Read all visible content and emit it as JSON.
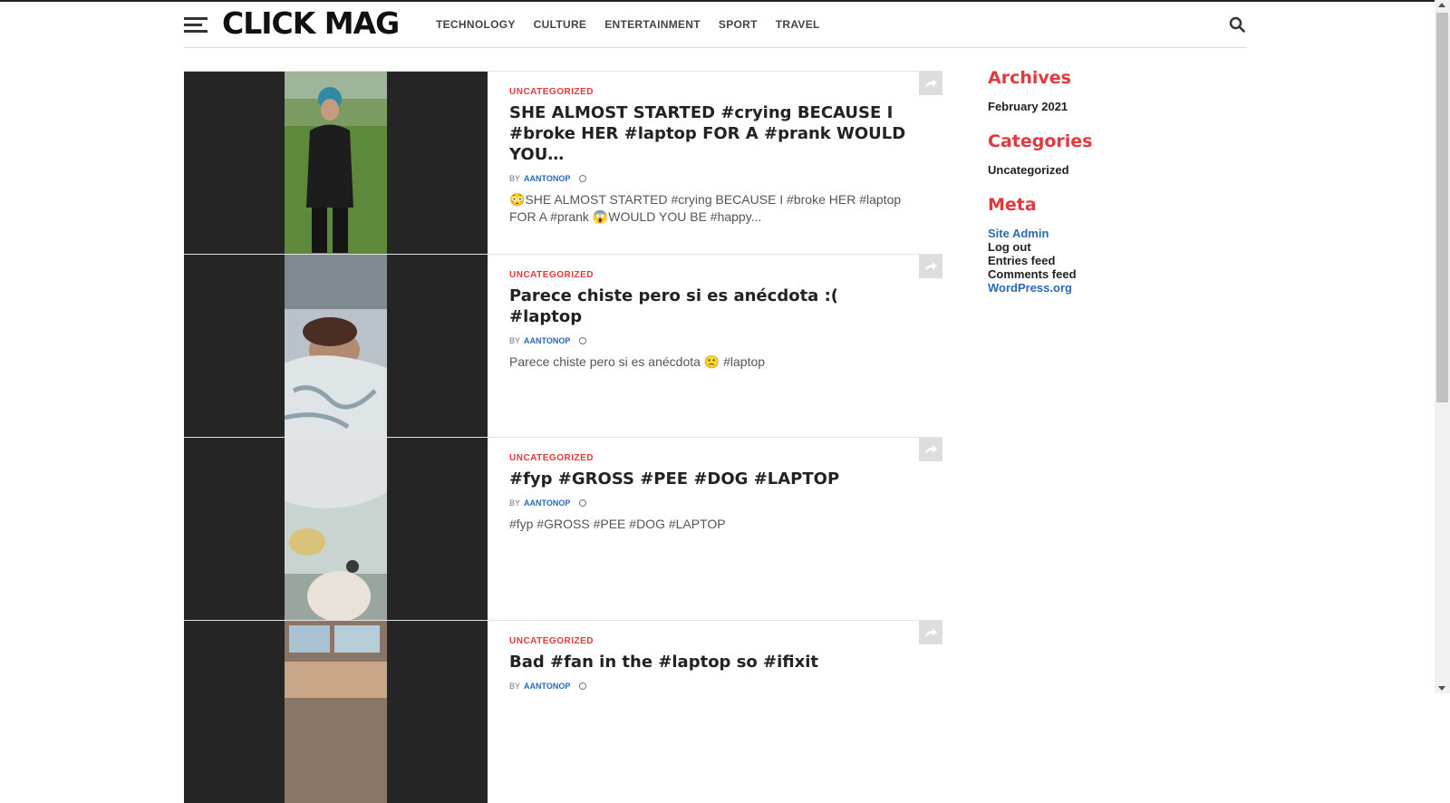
{
  "header": {
    "logo": "CLICK MAG",
    "nav": [
      "TECHNOLOGY",
      "CULTURE",
      "ENTERTAINMENT",
      "SPORT",
      "TRAVEL"
    ]
  },
  "posts": [
    {
      "category": "UNCATEGORIZED",
      "title": "SHE ALMOST STARTED #crying BECAUSE I #broke HER #laptop FOR A #prank WOULD YOU…",
      "by": "BY",
      "author": "AANTONOP",
      "excerpt": "😳SHE ALMOST STARTED #crying BECAUSE I #broke HER #laptop FOR A #prank 😱WOULD YOU BE #happy..."
    },
    {
      "category": "UNCATEGORIZED",
      "title": "Parece chiste pero si es anécdota :( #laptop",
      "by": "BY",
      "author": "AANTONOP",
      "excerpt": "Parece chiste pero si es anécdota 🙁 #laptop"
    },
    {
      "category": "UNCATEGORIZED",
      "title": "#fyp #GROSS #PEE #DOG #LAPTOP",
      "by": "BY",
      "author": "AANTONOP",
      "excerpt": "#fyp #GROSS #PEE #DOG #LAPTOP"
    },
    {
      "category": "UNCATEGORIZED",
      "title": "Bad #fan in the #laptop so #ifixit",
      "by": "BY",
      "author": "AANTONOP",
      "excerpt": ""
    }
  ],
  "sidebar": {
    "archives_title": "Archives",
    "archives": [
      "February 2021"
    ],
    "categories_title": "Categories",
    "categories": [
      "Uncategorized"
    ],
    "meta_title": "Meta",
    "meta": [
      "Site Admin",
      "Log out",
      "Entries feed",
      "Comments feed",
      "WordPress.org"
    ]
  },
  "colors": {
    "accent": "#e0393e",
    "link": "#2a6ab3",
    "thumb_bg": "#252525"
  }
}
